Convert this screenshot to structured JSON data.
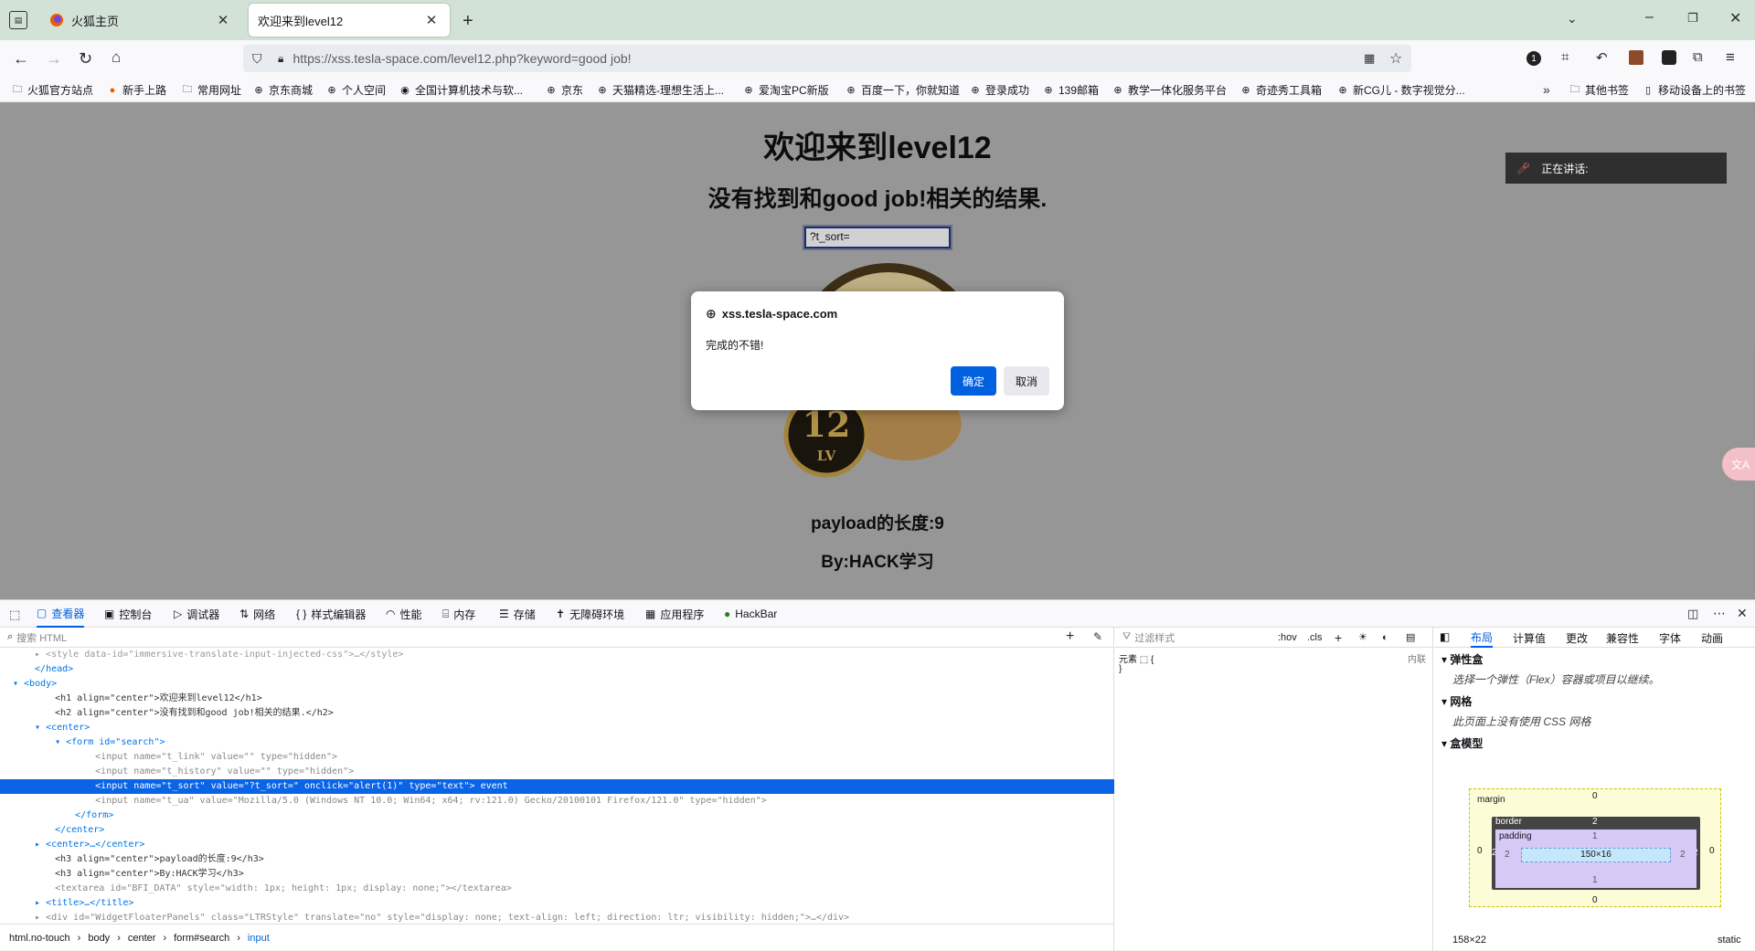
{
  "tabs": [
    {
      "label": "火狐主页",
      "active": false
    },
    {
      "label": "欢迎来到level12",
      "active": true
    }
  ],
  "url": "https://xss.tesla-space.com/level12.php?keyword=good job!",
  "bookmarks": [
    "火狐官方站点",
    "新手上路",
    "常用网址",
    "京东商城",
    "个人空间",
    "全国计算机技术与软...",
    "京东",
    "天猫精选-理想生活上...",
    "爱淘宝PC新版",
    "百度一下，你就知道",
    "登录成功",
    "139邮箱",
    "教学一体化服务平台",
    "奇迹秀工具箱",
    "新CG儿 - 数字视觉分...",
    "其他书签",
    "移动设备上的书签"
  ],
  "page": {
    "h1": "欢迎来到level12",
    "h2": "没有找到和good job!相关的结果.",
    "search_value": "?t_sort=",
    "badge_top": "12",
    "badge_bottom": "LV",
    "h3a": "payload的长度:9",
    "h3b": "By:HACK学习"
  },
  "speaker": {
    "label": "正在讲话:"
  },
  "dialog": {
    "host": "xss.tesla-space.com",
    "message": "完成的不错!",
    "ok": "确定",
    "cancel": "取消"
  },
  "devtools": {
    "tabs": [
      "查看器",
      "控制台",
      "调试器",
      "网络",
      "样式编辑器",
      "性能",
      "内存",
      "存储",
      "无障碍环境",
      "应用程序",
      "HackBar"
    ],
    "search_placeholder": "搜索 HTML",
    "tree": [
      "  ▸ <style data-id=\"immersive-translate-input-injected-css\">…</style>",
      "  </head>",
      "▾ <body>",
      "    <h1 align=\"center\">欢迎来到level12</h1>",
      "    <h2 align=\"center\">没有找到和good job!相关的结果.</h2>",
      "  ▾ <center>",
      "    ▾ <form id=\"search\">",
      "        <input name=\"t_link\" value=\"\" type=\"hidden\">",
      "        <input name=\"t_history\" value=\"\" type=\"hidden\">",
      "        <input name=\"t_sort\" value=\"?t_sort=\" onclick=\"alert(1)\" type=\"text\"> event",
      "        <input name=\"t_ua\" value=\"Mozilla/5.0 (Windows NT 10.0; Win64; x64; rv:121.0) Gecko/20100101 Firefox/121.0\" type=\"hidden\">",
      "      </form>",
      "    </center>",
      "  ▸ <center>…</center>",
      "    <h3 align=\"center\">payload的长度:9</h3>",
      "    <h3 align=\"center\">By:HACK学习</h3>",
      "    <textarea id=\"BFI_DATA\" style=\"width: 1px; height: 1px; display: none;\"></textarea>",
      "  ▸ <title>…</title>",
      "  ▸ <div id=\"WidgetFloaterPanels\" class=\"LTRStyle\" translate=\"no\" style=\"display: none; text-align: left; direction: ltr; visibility: hidden;\">…</div>"
    ],
    "crumbs": [
      "html.no-touch",
      "body",
      "center",
      "form#search",
      "input"
    ],
    "filter_placeholder": "过滤样式",
    "hov": ":hov",
    "cls": ".cls",
    "rule_line1": "元素 ⬚ {",
    "rule_line2": "}",
    "inline_label": "内联",
    "right_tabs": [
      "布局",
      "计算值",
      "更改",
      "兼容性",
      "字体",
      "动画"
    ],
    "flex_title": "弹性盒",
    "flex_note": "选择一个弹性（Flex）容器或项目以继续。",
    "grid_title": "网格",
    "grid_note": "此页面上没有使用 CSS 网格",
    "box_title": "盒模型",
    "box": {
      "margin": "margin",
      "border": "border",
      "padding": "padding",
      "content": "150×16",
      "m": "0",
      "b": "2",
      "p": "1",
      "side_p": "2"
    },
    "size_label": "158×22",
    "position_label": "static"
  }
}
